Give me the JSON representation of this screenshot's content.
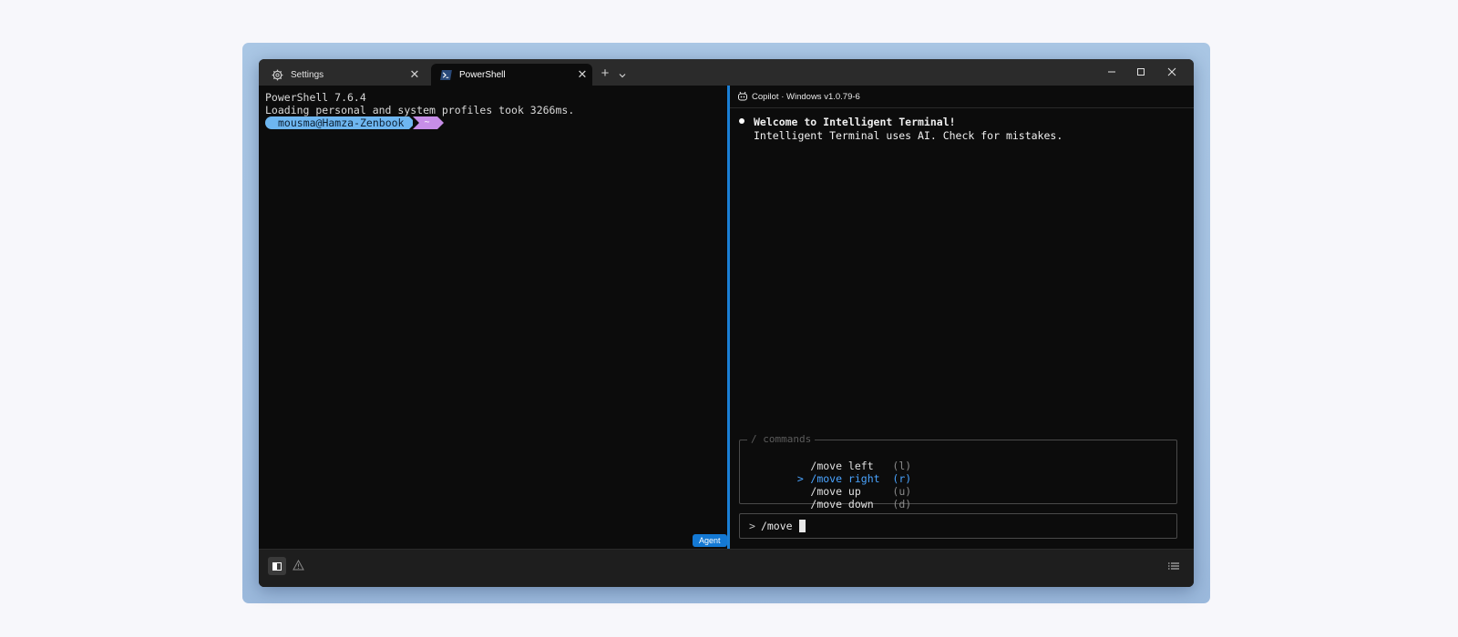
{
  "tabs": [
    {
      "label": "Settings",
      "icon": "gear-icon",
      "active": false
    },
    {
      "label": "PowerShell",
      "icon": "powershell-icon",
      "active": true
    }
  ],
  "titlebar": {
    "new_tab": "+",
    "close_glyph": "✕"
  },
  "left_pane": {
    "lines": [
      "PowerShell 7.6.4",
      "Loading personal and system profiles took 3266ms."
    ],
    "prompt": {
      "user_host": "mousma@Hamza-Zenbook",
      "dir": "~"
    },
    "agent_badge": "Agent"
  },
  "right_pane": {
    "header": "Copilot · Windows v1.0.79-6",
    "welcome": {
      "title": "Welcome to Intelligent Terminal!",
      "subtitle": "Intelligent Terminal uses AI. Check for mistakes."
    },
    "commands": {
      "title": "/ commands",
      "items": [
        {
          "marker": "",
          "command": "/move left",
          "key": "(l)",
          "selected": false
        },
        {
          "marker": ">",
          "command": "/move right",
          "key": "(r)",
          "selected": true
        },
        {
          "marker": "",
          "command": "/move up",
          "key": "(u)",
          "selected": false
        },
        {
          "marker": "",
          "command": "/move down",
          "key": "(d)",
          "selected": false
        }
      ]
    },
    "input": {
      "prompt": ">",
      "value": "/move"
    }
  },
  "colors": {
    "accent": "#1a7fd6",
    "prompt_user_bg": "#6eb6f0",
    "prompt_dir_bg": "#c78ee8",
    "selected_command": "#4aa4ff",
    "frame": "#a9c6e4"
  }
}
